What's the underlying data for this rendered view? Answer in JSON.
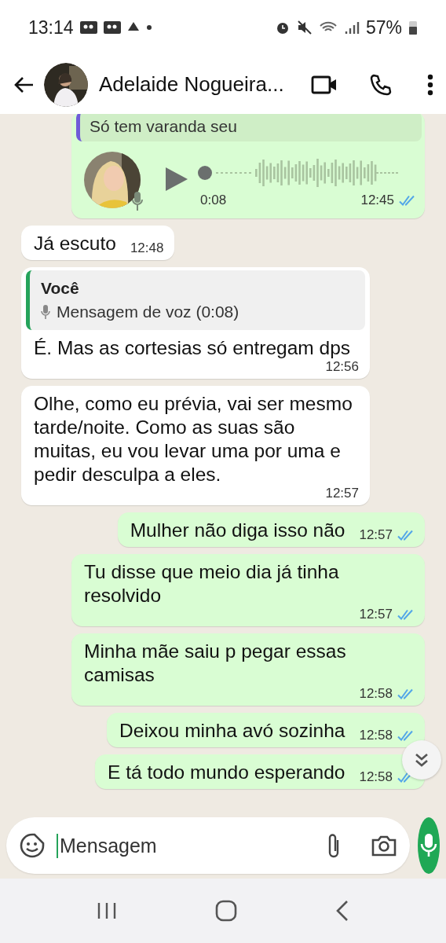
{
  "status_bar": {
    "time": "13:14",
    "battery": "57%"
  },
  "header": {
    "contact_name": "Adelaide Nogueira..."
  },
  "messages": [
    {
      "kind": "voice",
      "outgoing": true,
      "quote_text": "Só tem varanda seu",
      "duration": "0:08",
      "time": "12:45",
      "read": true
    },
    {
      "kind": "text",
      "outgoing": false,
      "text": "Já escuto",
      "time": "12:48"
    },
    {
      "kind": "reply",
      "outgoing": false,
      "quote_author": "Você",
      "quote_text": "Mensagem de voz (0:08)",
      "text": "É. Mas as cortesias só entregam dps",
      "time": "12:56"
    },
    {
      "kind": "text",
      "outgoing": false,
      "text": "Olhe, como eu prévia, vai ser mesmo tarde/noite. Como as suas são muitas, eu vou levar uma por uma e pedir desculpa a eles.",
      "time": "12:57"
    },
    {
      "kind": "text",
      "outgoing": true,
      "text": "Mulher não diga isso não",
      "time": "12:57",
      "read": true
    },
    {
      "kind": "text",
      "outgoing": true,
      "text": "Tu disse que meio dia já tinha resolvido",
      "time": "12:57",
      "read": true
    },
    {
      "kind": "text",
      "outgoing": true,
      "text": "Minha mãe saiu p pegar essas camisas",
      "time": "12:58",
      "read": true
    },
    {
      "kind": "text",
      "outgoing": true,
      "text": "Deixou minha avó sozinha",
      "time": "12:58",
      "read": true
    },
    {
      "kind": "text",
      "outgoing": true,
      "text": "E tá todo mundo esperando",
      "time": "12:58",
      "read": true
    }
  ],
  "composer": {
    "placeholder": "Mensagem"
  }
}
